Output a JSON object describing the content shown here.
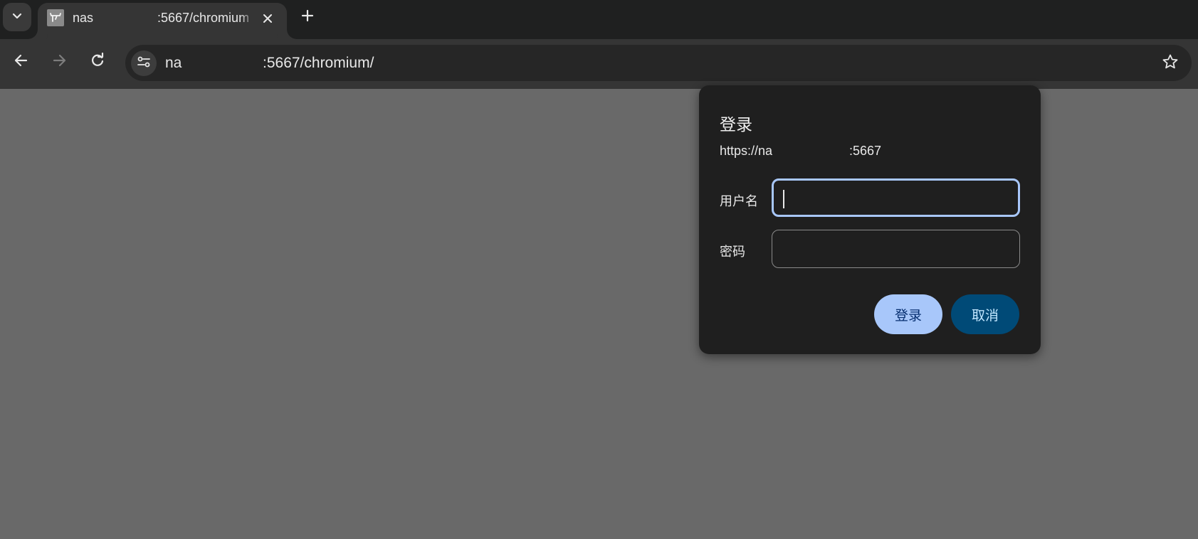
{
  "browser": {
    "tab": {
      "title_start": "nas",
      "title_end": ":5667/chromium"
    },
    "address_bar": {
      "url_start": "na",
      "url_end": ":5667/chromium/"
    }
  },
  "auth_dialog": {
    "title": "登录",
    "origin_start": "https://na",
    "origin_end": ":5667",
    "username_label": "用户名",
    "username_value": "",
    "password_label": "密码",
    "password_value": "",
    "sign_in_label": "登录",
    "cancel_label": "取消"
  },
  "colors": {
    "page_background": "#696969",
    "dialog_background": "#1f1f1f",
    "focus_ring": "#a8c7fa",
    "primary_button": "#a8c7fa",
    "secondary_button": "#004a77"
  },
  "icons": {
    "tab_search": "chevron-down-icon",
    "favicon": "site-favicon-icon",
    "tab_close": "close-icon",
    "new_tab": "plus-icon",
    "back": "arrow-left-icon",
    "forward": "arrow-right-icon",
    "reload": "reload-icon",
    "site_info": "tune-icon",
    "bookmark": "star-icon"
  }
}
